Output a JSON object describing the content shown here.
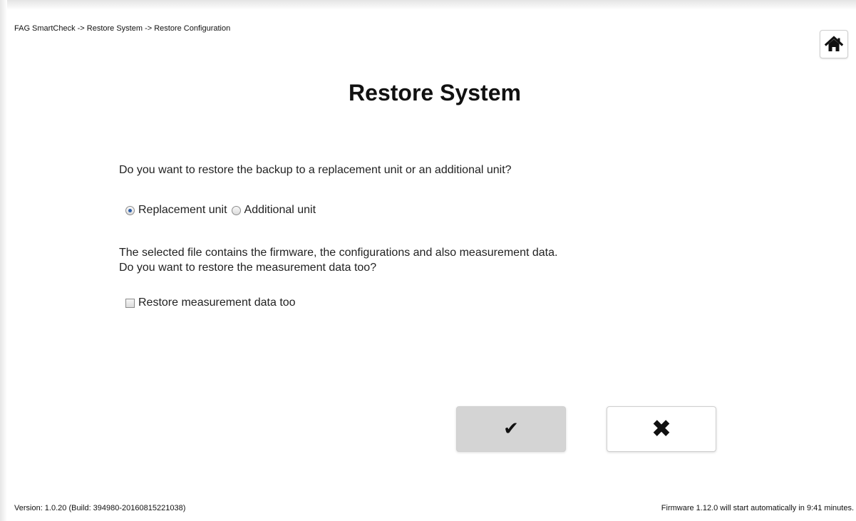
{
  "breadcrumb": "FAG SmartCheck -> Restore System -> Restore Configuration",
  "page_title": "Restore System",
  "question": "Do you want to restore the backup to a replacement unit or an additional unit?",
  "unit_options": {
    "replacement_label": "Replacement unit",
    "replacement_checked": true,
    "additional_label": "Additional unit",
    "additional_checked": false
  },
  "info": {
    "line1": "The selected file contains the firmware, the configurations and also measurement data.",
    "line2": "Do you want to restore the measurement data too?"
  },
  "restore_measurement": {
    "label": "Restore measurement data too",
    "checked": false
  },
  "buttons": {
    "confirm_glyph": "✔",
    "cancel_glyph": "✖"
  },
  "icons": {
    "home": "home-icon",
    "confirm": "checkmark-icon",
    "cancel": "close-icon"
  },
  "footer": {
    "version": "Version: 1.0.20 (Build: 394980-20160815221038)",
    "firmware": "Firmware 1.12.0 will start automatically in 9:41 minutes."
  }
}
